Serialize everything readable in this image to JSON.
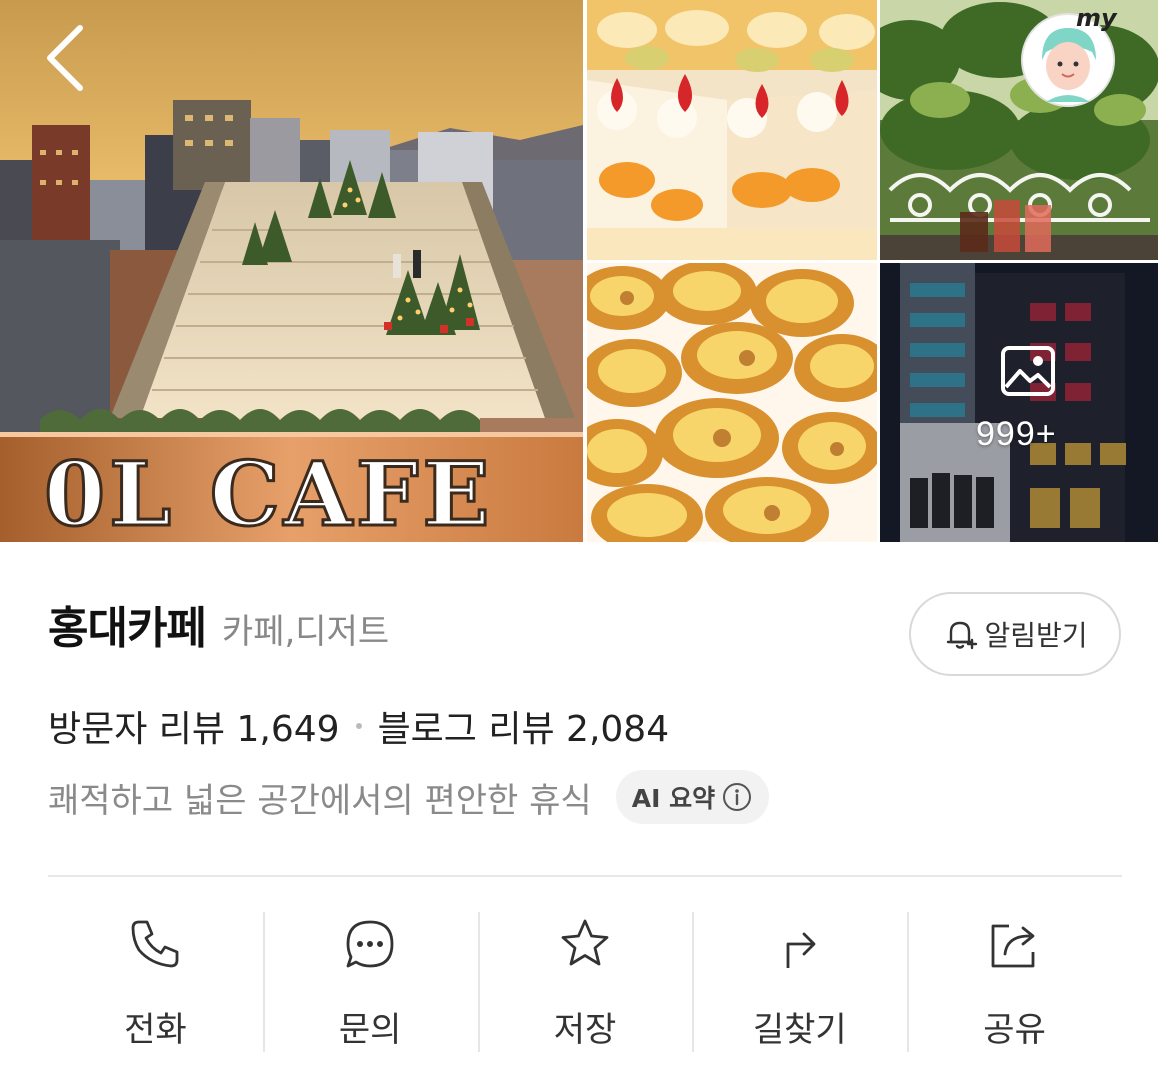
{
  "place": {
    "name": "홍대카페",
    "category": "카페,디저트"
  },
  "gallery": {
    "photo_count_label": "999+",
    "sign_text": "0L CAFE",
    "tiles": [
      {
        "subject": "rooftop-cafe-christmas"
      },
      {
        "subject": "fruit-cakes"
      },
      {
        "subject": "garden-drinks"
      },
      {
        "subject": "egg-tarts"
      },
      {
        "subject": "building-night"
      }
    ]
  },
  "header": {
    "back_icon": "chevron-left-icon",
    "my_label": "my"
  },
  "alert_button": {
    "label": "알림받기",
    "icon": "bell-plus-icon"
  },
  "reviews": {
    "visitor": "방문자 리뷰 1,649",
    "blog": "블로그 리뷰 2,084"
  },
  "summary": {
    "text": "쾌적하고 넓은 공간에서의 편안한 휴식",
    "ai_label": "AI 요약"
  },
  "actions": [
    {
      "label": "전화",
      "icon": "phone-icon"
    },
    {
      "label": "문의",
      "icon": "chat-icon"
    },
    {
      "label": "저장",
      "icon": "star-icon"
    },
    {
      "label": "길찾기",
      "icon": "directions-icon"
    },
    {
      "label": "공유",
      "icon": "share-icon"
    }
  ],
  "colors": {
    "text_primary": "#111111",
    "text_secondary": "#888888",
    "border": "#d9d9d9",
    "chip_bg": "#f2f2f2"
  }
}
